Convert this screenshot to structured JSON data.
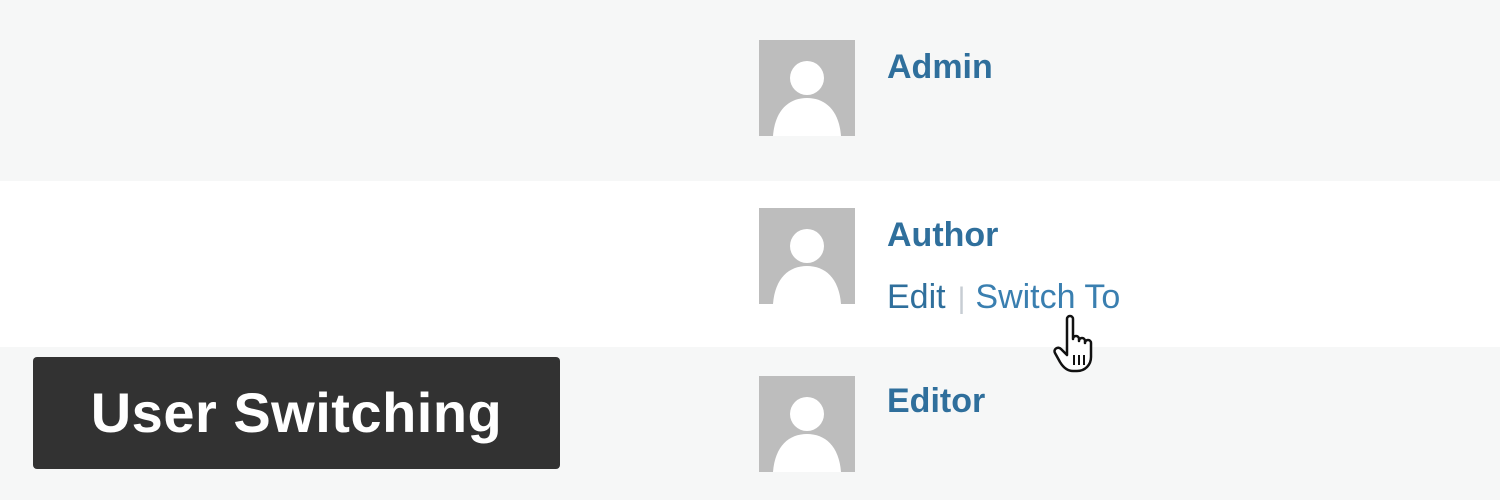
{
  "users": [
    {
      "name": "Admin"
    },
    {
      "name": "Author",
      "actions": {
        "edit": "Edit",
        "separator": "|",
        "switch_to": "Switch To"
      }
    },
    {
      "name": "Editor"
    }
  ],
  "plugin_label": "User Switching",
  "colors": {
    "link": "#2f6f9c",
    "link_hover": "#3a7fb0",
    "avatar_bg": "#bdbdbd",
    "label_bg": "#323232",
    "row_alt_bg": "#f6f7f7",
    "row_bg": "#ffffff"
  },
  "icons": {
    "avatar": "default-person-avatar-icon",
    "cursor": "hand-pointer-cursor-icon"
  }
}
